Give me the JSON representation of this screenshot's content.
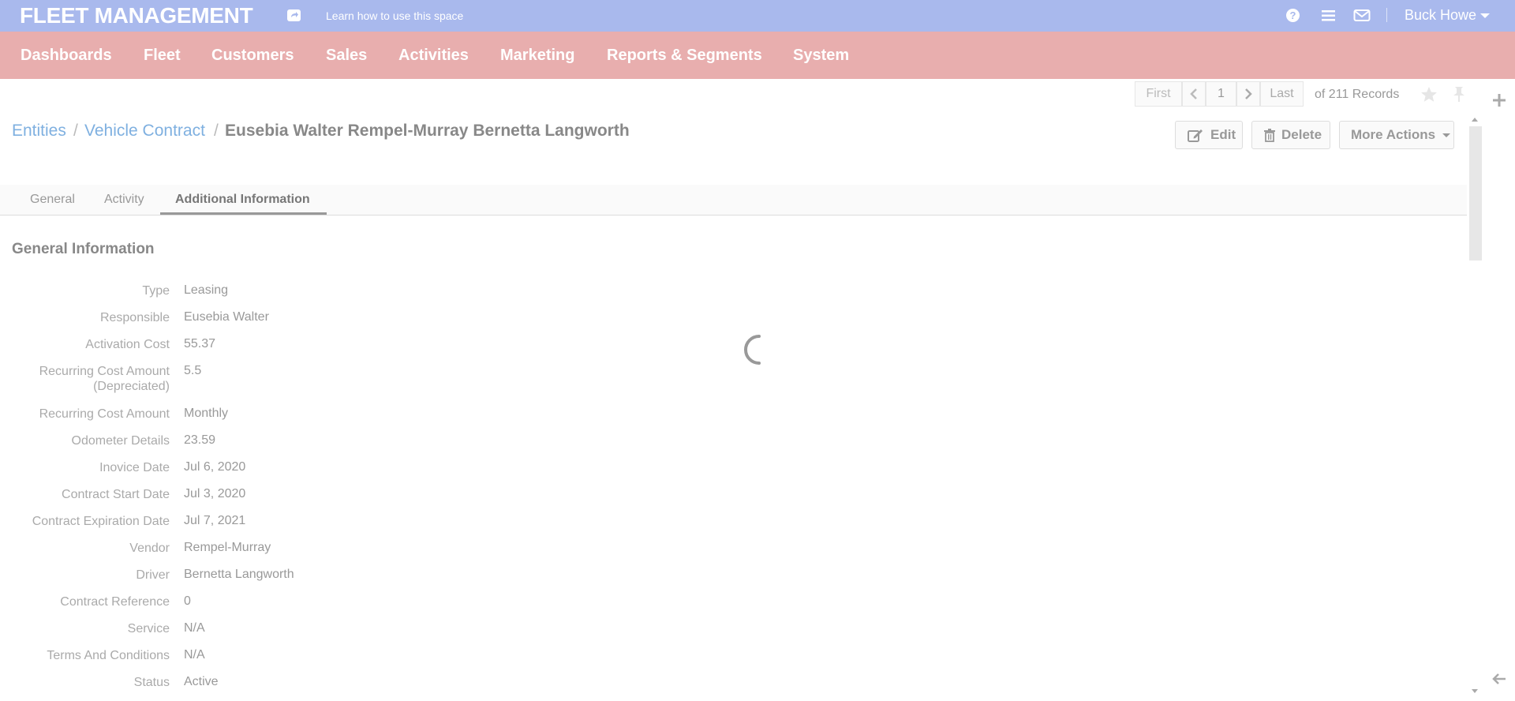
{
  "topbar": {
    "brand": "FLEET MANAGEMENT",
    "learn_link": "Learn how to use this space",
    "icons": [
      "share-icon",
      "help-icon",
      "list-icon",
      "mail-icon"
    ],
    "user_name": "Buck Howe"
  },
  "menu": [
    "Dashboards",
    "Fleet",
    "Customers",
    "Sales",
    "Activities",
    "Marketing",
    "Reports & Segments",
    "System"
  ],
  "pager": {
    "first": "First",
    "page": "1",
    "last": "Last",
    "records": "of 211 Records"
  },
  "breadcrumb": {
    "entities": "Entities",
    "separator": "/",
    "entity": "Vehicle Contract",
    "current": "Eusebia Walter Rempel-Murray Bernetta Langworth"
  },
  "actions": {
    "edit": "Edit",
    "delete": "Delete",
    "more": "More Actions"
  },
  "tabs": [
    "General",
    "Activity",
    "Additional Information"
  ],
  "active_tab": "Additional Information",
  "section": {
    "title": "General Information",
    "fields": [
      {
        "label": "Type",
        "value": "Leasing"
      },
      {
        "label": "Responsible",
        "value": "Eusebia Walter"
      },
      {
        "label": "Activation Cost",
        "value": "55.37"
      },
      {
        "label": "Recurring Cost Amount",
        "label2": "(Depreciated)",
        "value": "5.5"
      },
      {
        "label": "Recurring Cost Amount",
        "value": "Monthly"
      },
      {
        "label": "Odometer Details",
        "value": "23.59"
      },
      {
        "label": "Inovice Date",
        "value": "Jul 6, 2020"
      },
      {
        "label": "Contract Start Date",
        "value": "Jul 3, 2020"
      },
      {
        "label": "Contract Expiration Date",
        "value": "Jul 7, 2021"
      },
      {
        "label": "Vendor",
        "value": "Rempel-Murray"
      },
      {
        "label": "Driver",
        "value": "Bernetta Langworth"
      },
      {
        "label": "Contract Reference",
        "value": "0"
      },
      {
        "label": "Service",
        "value": "N/A"
      },
      {
        "label": "Terms And Conditions",
        "value": "N/A"
      },
      {
        "label": "Status",
        "value": "Active"
      }
    ]
  },
  "colors": {
    "topbar": "#a9b9ed",
    "menubar": "#e8aeae",
    "link": "#7fb0e0"
  }
}
